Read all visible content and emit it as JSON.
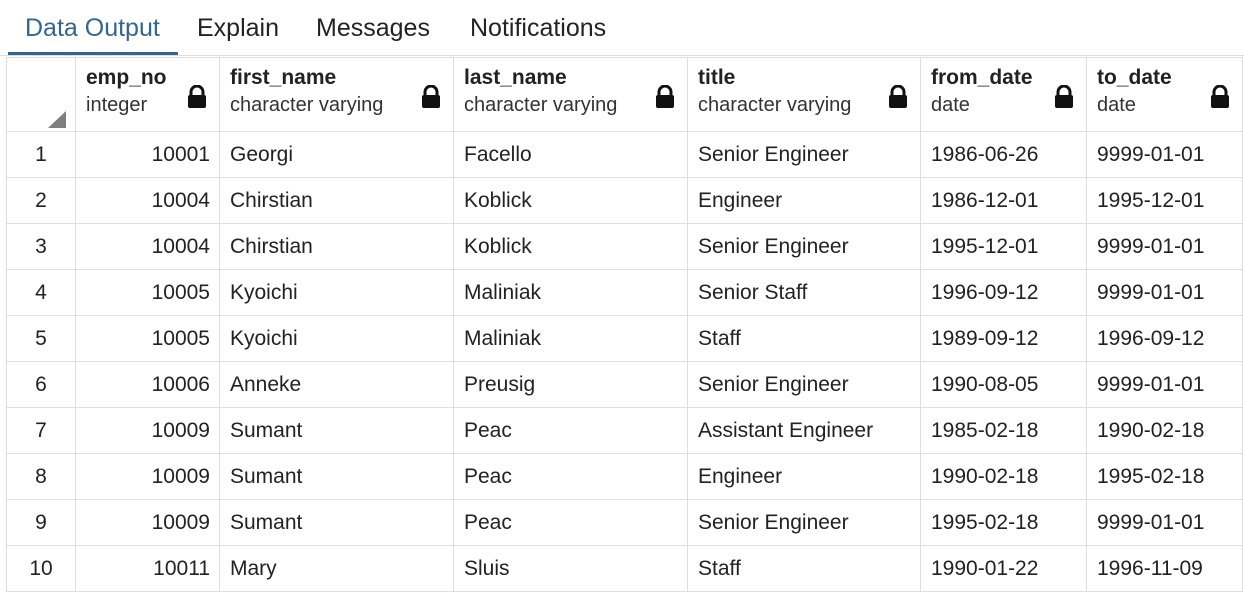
{
  "tabs": [
    {
      "label": "Data Output",
      "active": true
    },
    {
      "label": "Explain",
      "active": false
    },
    {
      "label": "Messages",
      "active": false
    },
    {
      "label": "Notifications",
      "active": false
    }
  ],
  "columns": [
    {
      "name": "emp_no",
      "type": "integer",
      "icon": "lock-icon"
    },
    {
      "name": "first_name",
      "type": "character varying",
      "icon": "lock-icon"
    },
    {
      "name": "last_name",
      "type": "character varying",
      "icon": "lock-icon"
    },
    {
      "name": "title",
      "type": "character varying",
      "icon": "lock-icon"
    },
    {
      "name": "from_date",
      "type": "date",
      "icon": "lock-icon"
    },
    {
      "name": "to_date",
      "type": "date",
      "icon": "lock-icon"
    }
  ],
  "rows": [
    {
      "n": "1",
      "cells": [
        "10001",
        "Georgi",
        "Facello",
        "Senior Engineer",
        "1986-06-26",
        "9999-01-01"
      ]
    },
    {
      "n": "2",
      "cells": [
        "10004",
        "Chirstian",
        "Koblick",
        "Engineer",
        "1986-12-01",
        "1995-12-01"
      ]
    },
    {
      "n": "3",
      "cells": [
        "10004",
        "Chirstian",
        "Koblick",
        "Senior Engineer",
        "1995-12-01",
        "9999-01-01"
      ]
    },
    {
      "n": "4",
      "cells": [
        "10005",
        "Kyoichi",
        "Maliniak",
        "Senior Staff",
        "1996-09-12",
        "9999-01-01"
      ]
    },
    {
      "n": "5",
      "cells": [
        "10005",
        "Kyoichi",
        "Maliniak",
        "Staff",
        "1989-09-12",
        "1996-09-12"
      ]
    },
    {
      "n": "6",
      "cells": [
        "10006",
        "Anneke",
        "Preusig",
        "Senior Engineer",
        "1990-08-05",
        "9999-01-01"
      ]
    },
    {
      "n": "7",
      "cells": [
        "10009",
        "Sumant",
        "Peac",
        "Assistant Engineer",
        "1985-02-18",
        "1990-02-18"
      ]
    },
    {
      "n": "8",
      "cells": [
        "10009",
        "Sumant",
        "Peac",
        "Engineer",
        "1990-02-18",
        "1995-02-18"
      ]
    },
    {
      "n": "9",
      "cells": [
        "10009",
        "Sumant",
        "Peac",
        "Senior Engineer",
        "1995-02-18",
        "9999-01-01"
      ]
    },
    {
      "n": "10",
      "cells": [
        "10011",
        "Mary",
        "Sluis",
        "Staff",
        "1990-01-22",
        "1996-11-09"
      ]
    }
  ],
  "colors": {
    "active_tab": "#326690",
    "grid_border": "#dedede",
    "text": "#222222"
  }
}
